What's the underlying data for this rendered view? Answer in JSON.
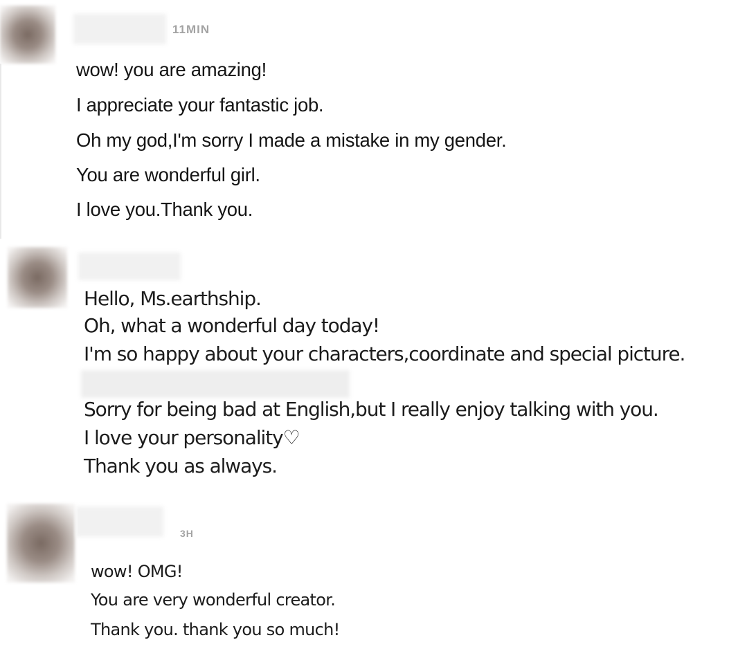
{
  "comments": [
    {
      "time": "11MIN",
      "lines": [
        "wow! you are amazing!",
        "I appreciate your fantastic job.",
        "Oh my god,I'm sorry I made a mistake in my gender.",
        "You are wonderful girl.",
        "I love you.Thank you."
      ]
    },
    {
      "lines": [
        "Hello, Ms.earthship.",
        "Oh, what a wonderful day today!",
        "I'm so happy about your characters,coordinate and special picture.",
        "Sorry for being bad at English,but I really enjoy talking with you.",
        "I love your personality♡",
        "Thank you as always."
      ]
    },
    {
      "time": "3H",
      "lines": [
        "wow! OMG!",
        "You are very wonderful creator.",
        "Thank you. thank you so much!"
      ]
    }
  ]
}
